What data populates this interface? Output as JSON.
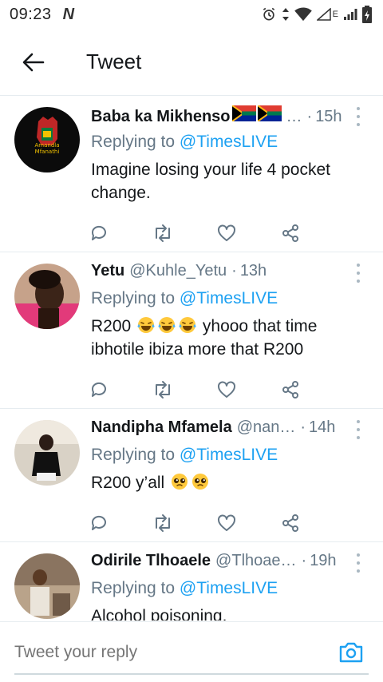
{
  "status_bar": {
    "time": "09:23",
    "app_icon": "N",
    "lte": "E"
  },
  "header": {
    "title": "Tweet",
    "back_icon": "arrow-left-icon"
  },
  "tweets": [
    {
      "name": "Baba ka Mikhenso",
      "handle": "",
      "time": "15h",
      "replying_prefix": "Replying to",
      "replying_to": "@TimesLIVE",
      "text": "Imagine losing your life 4 pocket change."
    },
    {
      "name": "Yetu",
      "handle": "@Kuhle_Yetu",
      "time": "13h",
      "replying_prefix": "Replying to",
      "replying_to": "@TimesLIVE",
      "text_before_emoji": "R200",
      "text_after_emoji": "yhooo that time ibhotile ibiza more that R200"
    },
    {
      "name": "Nandipha Mfamela",
      "handle": "@nan…",
      "time": "14h",
      "replying_prefix": "Replying to",
      "replying_to": "@TimesLIVE",
      "text_before_emoji": "R200 y’all"
    },
    {
      "name": "Odirile Tlhoaele",
      "handle": "@Tlhoae…",
      "time": "19h",
      "replying_prefix": "Replying to",
      "replying_to": "@TimesLIVE",
      "text": "Alcohol poisoning."
    }
  ],
  "composer": {
    "placeholder": "Tweet your reply",
    "camera_icon": "camera-icon"
  },
  "colors": {
    "accent": "#1da1f2",
    "secondary": "#657786",
    "divider": "#e6ecf0",
    "icon": "#657786"
  }
}
